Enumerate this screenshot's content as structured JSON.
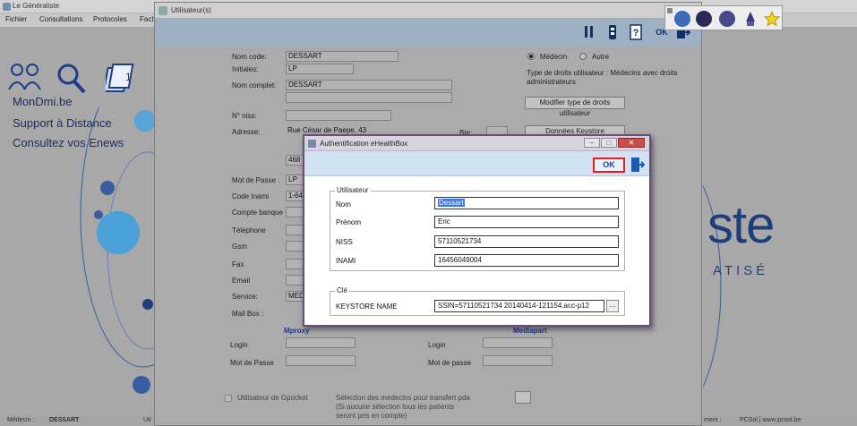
{
  "app": {
    "title": "Le Généraliste",
    "menu": [
      "Fichier",
      "Consultations",
      "Protocoles",
      "Fact"
    ],
    "links": [
      "MonDmi.be",
      "Support à Distance",
      "Consultez vos Enews"
    ],
    "logo_text": "ste",
    "logo_sub": "ATISÉ",
    "status": {
      "medecin_label": "Médecin :",
      "medecin_value": "DESSART",
      "util_label": "Uti",
      "right_label": "ment :",
      "right_value": "PCSol | www.pcsol.be"
    }
  },
  "user_window": {
    "title": "Utilisateur(s)",
    "toolbar_ok": "OK",
    "fields": {
      "nom_code_label": "Nom code:",
      "nom_code_value": "DESSART",
      "initiales_label": "Initiales:",
      "initiales_value": "LP",
      "nom_complet_label": "Nom complet:",
      "nom_complet_value": "DESSART",
      "niss_label": "N° niss:",
      "adresse_label": "Adresse:",
      "adresse_value": "Rue César de Paepe, 43",
      "adresse_cp": "468",
      "bte_label": "Bte:",
      "mot_de_passe_label": "Mot de Passe :",
      "mot_de_passe_value": "LP",
      "code_inami_label": "Code Inami",
      "code_inami_value": "1-64",
      "compte_banque_label": "Compte banque",
      "telephone_label": "Téléphone",
      "gsm_label": "Gsm",
      "fax_label": "Fax",
      "email_label": "Email",
      "service_label": "Service:",
      "service_value": "MED",
      "mail_box_label": "Mail Box :"
    },
    "radio_medecin": "Médecin",
    "radio_autre": "Autre",
    "droits_text": "Type de droits utilisateur : Médecins avec droits administrateurs",
    "modifier_btn": "Modifier type de droits utilisateur",
    "keystore_btn": "Données Keystore",
    "mproxy_label": "Mproxy",
    "mediapart_label": "Mediapart",
    "login_label": "Login",
    "mot_de_passe_left": "Mot de Passe",
    "login_right": "Login",
    "mot_de_passe_right": "Mot de passe",
    "gpocket_label": "Utilisateur de Gpocket",
    "selection_text_1": "Sélection des médecins pour transfert pda",
    "selection_text_2": "(Si aucune sélection tous les patients",
    "selection_text_3": "seront pris en compte)"
  },
  "modal": {
    "title": "Authentification eHealthBox",
    "ok_label": "OK",
    "utilisateur_legend": "Utilisateur",
    "nom_label": "Nom",
    "nom_value": "Dessart",
    "prenom_label": "Prénom",
    "prenom_value": "Eric",
    "niss_label": "NISS",
    "niss_value": "57110521734",
    "inami_label": "INAMI",
    "inami_value": "16456049004",
    "cle_legend": "Clé",
    "keystore_label": "KEYSTORE NAME",
    "keystore_value": "SSIN=57110521734 20140414-121154.acc-p12",
    "browse_label": "..."
  }
}
